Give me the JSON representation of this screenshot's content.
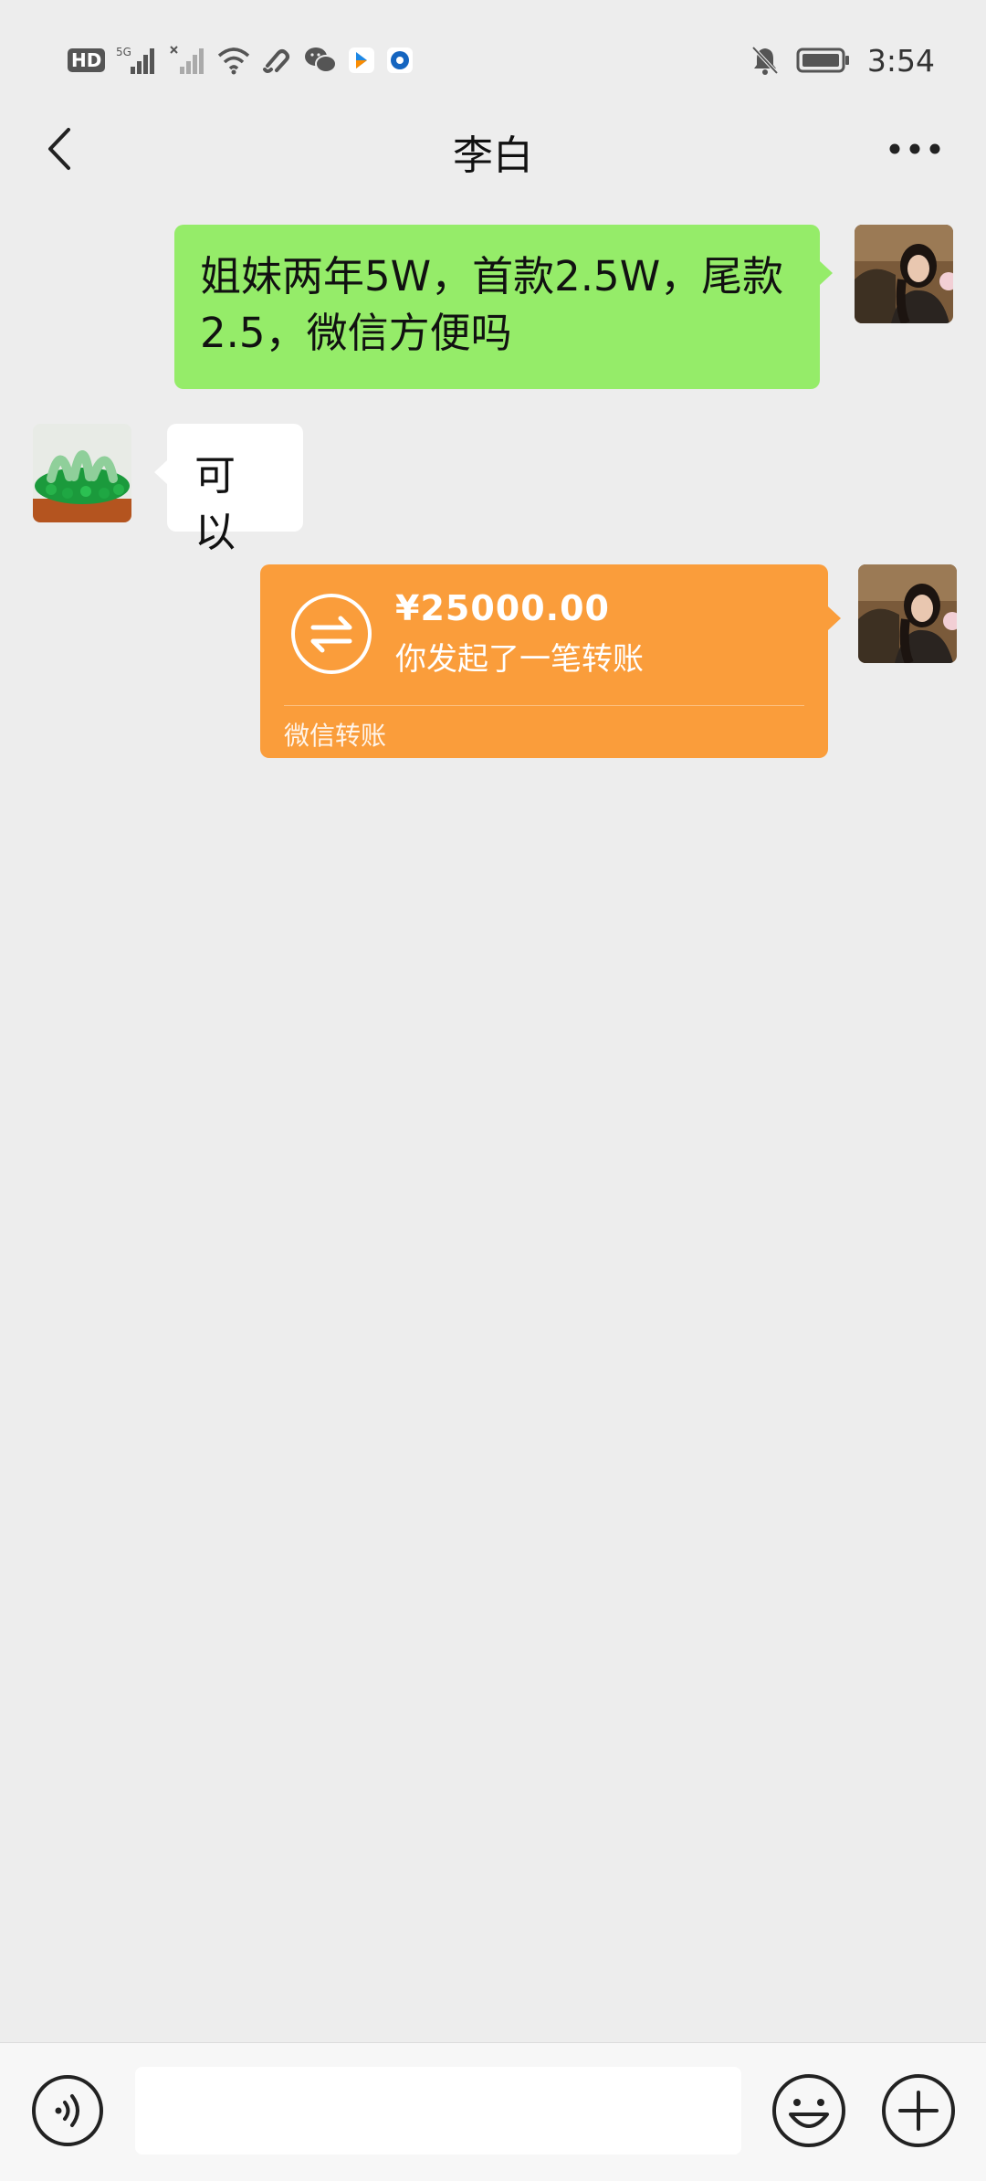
{
  "status_bar": {
    "hd_label": "HD",
    "net_label": "5G",
    "time": "3:54",
    "icons": [
      "hd-icon",
      "signal-5g-icon",
      "signal-nosim-icon",
      "wifi-icon",
      "link-icon",
      "wechat-icon",
      "app-icon",
      "circle-app-icon",
      "bell-off-icon",
      "battery-icon"
    ]
  },
  "header": {
    "title": "李白"
  },
  "messages": [
    {
      "side": "right",
      "type": "text",
      "text": "姐妹两年5W，首款2.5W，尾款2.5，微信方便吗"
    },
    {
      "side": "left",
      "type": "text",
      "text": "可以"
    },
    {
      "side": "right",
      "type": "transfer",
      "amount": "¥25000.00",
      "description": "你发起了一笔转账",
      "label": "微信转账"
    }
  ],
  "input_bar": {
    "value": "",
    "placeholder": ""
  },
  "colors": {
    "background": "#ededed",
    "sent_bubble": "#95ec69",
    "received_bubble": "#ffffff",
    "transfer_card": "#fa9d3b"
  }
}
